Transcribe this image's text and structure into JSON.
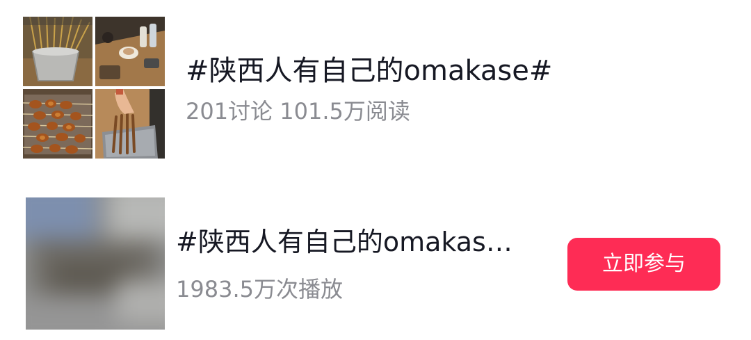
{
  "topic": {
    "title": "#陕西人有自己的omakase#",
    "stats": "201讨论 101.5万阅读",
    "cover_images": [
      {
        "icon": "skewer-bundle-photo"
      },
      {
        "icon": "dining-table-photo"
      },
      {
        "icon": "grilled-skewers-photo"
      },
      {
        "icon": "hand-holding-skewers-photo"
      }
    ]
  },
  "video": {
    "title": "#陕西人有自己的omakas…",
    "stats": "1983.5万次播放",
    "thumbnail": {
      "icon": "blurred-video-thumbnail"
    },
    "join_label": "立即参与"
  },
  "colors": {
    "accent": "#fe2c55",
    "title_text": "#161823",
    "secondary_text": "#8a8b91",
    "background": "#ffffff"
  }
}
